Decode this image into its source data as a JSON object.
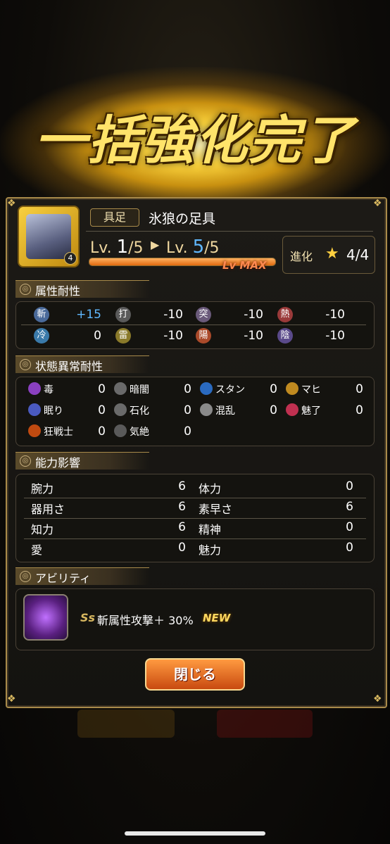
{
  "title": "一括強化完了",
  "item": {
    "tag": "具足",
    "name": "氷狼の足具",
    "icon_num": "4",
    "lv_prefix": "Lv.",
    "lv_from": "1",
    "lv_from_max": "/5",
    "lv_to": "5",
    "lv_to_max": "/5",
    "lv_max_label": "Lv MAX",
    "level_progress": 1.0,
    "evolve_label": "進化",
    "evolve_value": "4/4"
  },
  "sections": {
    "attr": "属性耐性",
    "status": "状態異常耐性",
    "ability_effect": "能力影響",
    "abilities": "アビリティ"
  },
  "attr_res": [
    {
      "icon": "斬",
      "value": "+15",
      "highlight": true
    },
    {
      "icon": "打",
      "value": "-10"
    },
    {
      "icon": "突",
      "value": "-10"
    },
    {
      "icon": "熱",
      "value": "-10"
    },
    {
      "icon": "冷",
      "value": "0"
    },
    {
      "icon": "雷",
      "value": "-10"
    },
    {
      "icon": "陽",
      "value": "-10"
    },
    {
      "icon": "陰",
      "value": "-10"
    }
  ],
  "status_res": [
    {
      "label": "毒",
      "value": "0"
    },
    {
      "label": "暗闇",
      "value": "0"
    },
    {
      "label": "スタン",
      "value": "0"
    },
    {
      "label": "マヒ",
      "value": "0"
    },
    {
      "label": "眠り",
      "value": "0"
    },
    {
      "label": "石化",
      "value": "0"
    },
    {
      "label": "混乱",
      "value": "0"
    },
    {
      "label": "魅了",
      "value": "0"
    },
    {
      "label": "狂戦士",
      "value": "0"
    },
    {
      "label": "気絶",
      "value": "0"
    }
  ],
  "stats": [
    {
      "label": "腕力",
      "value": "6"
    },
    {
      "label": "体力",
      "value": "0"
    },
    {
      "label": "器用さ",
      "value": "6"
    },
    {
      "label": "素早さ",
      "value": "6"
    },
    {
      "label": "知力",
      "value": "6"
    },
    {
      "label": "精神",
      "value": "0"
    },
    {
      "label": "愛",
      "value": "0"
    },
    {
      "label": "魅力",
      "value": "0"
    }
  ],
  "ability": {
    "text": "斬属性攻撃＋ 30%",
    "badge": "NEW"
  },
  "close_label": "閉じる"
}
